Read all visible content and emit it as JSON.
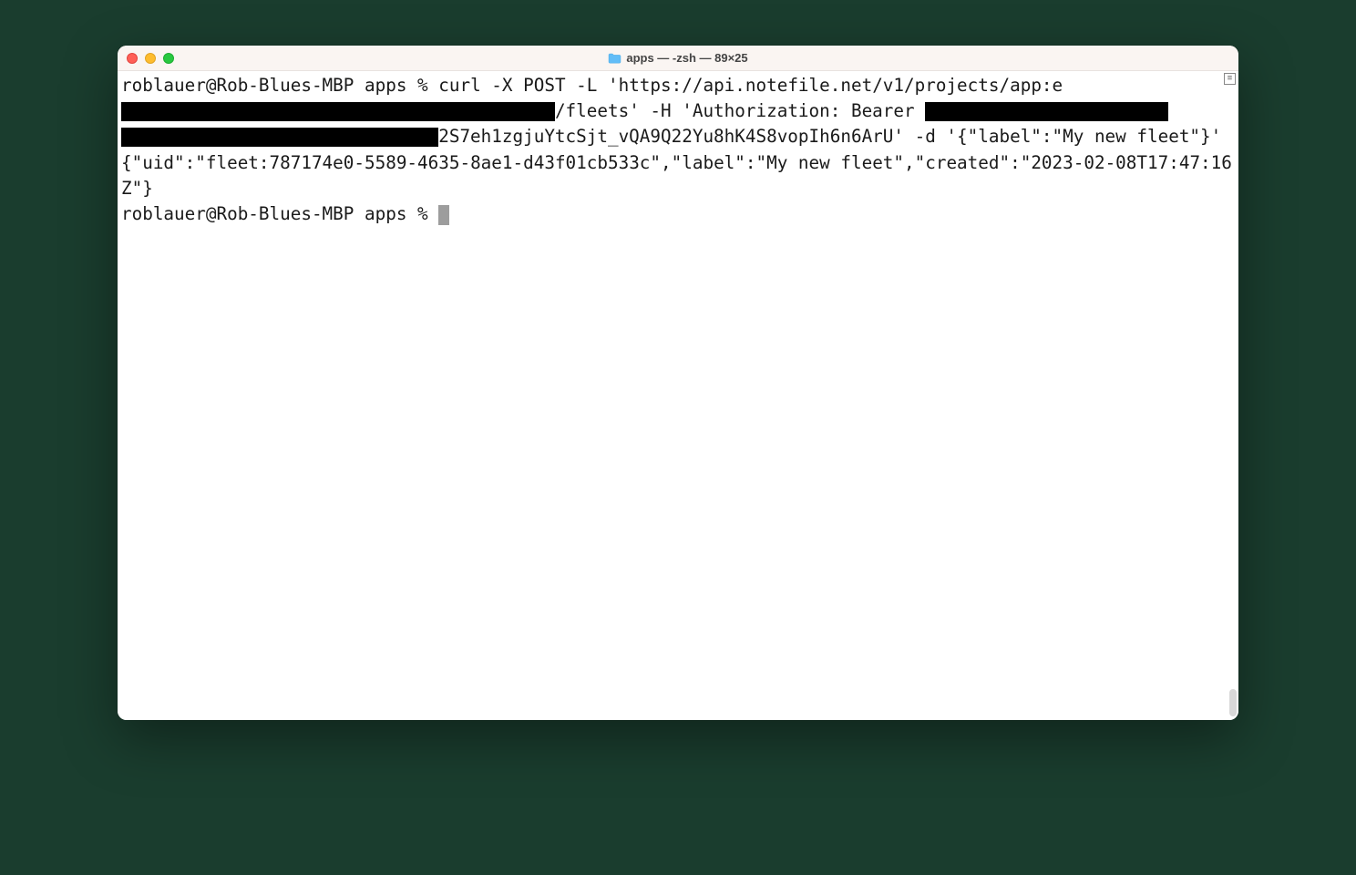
{
  "window": {
    "title": "apps — -zsh — 89×25"
  },
  "terminal": {
    "parts": {
      "p1": "roblauer@Rob-Blues-MBP apps % curl -X POST -L 'https://api.notefile.net/v1/projects/app:e",
      "redact1_width": "41ch",
      "p2": "/fleets' -H 'Authorization: Bearer ",
      "redact2_width": "23ch",
      "redact3_width": "30ch",
      "p3": "2S7eh1zgjuYtcSjt_vQA9Q22Yu8hK4S8vopIh6n6ArU' -d '{\"label\":\"My new fleet\"}'",
      "response": "{\"uid\":\"fleet:787174e0-5589-4635-8ae1-d43f01cb533c\",\"label\":\"My new fleet\",\"created\":\"2023-02-08T17:47:16Z\"}",
      "prompt2": "roblauer@Rob-Blues-MBP apps % "
    }
  }
}
